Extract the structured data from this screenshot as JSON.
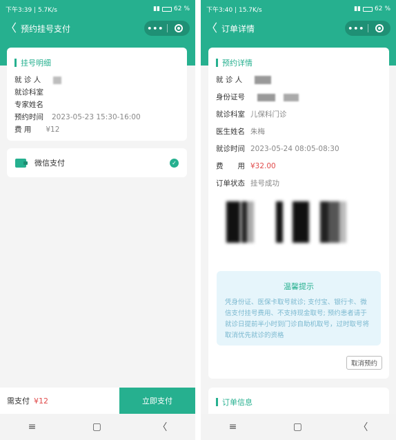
{
  "left": {
    "status": {
      "time_speed": "下午3:39 | 5.7K/s",
      "battery": "62"
    },
    "nav": {
      "back": "〈",
      "title": "预约挂号支付",
      "dots": "•••"
    },
    "detail": {
      "section": "挂号明细",
      "rows": [
        {
          "label": "就 诊 人",
          "value": ""
        },
        {
          "label": "就诊科室",
          "value": ""
        },
        {
          "label": "专家姓名",
          "value": ""
        },
        {
          "label": "预约时间",
          "value": "2023-05-23 15:30-16:00"
        },
        {
          "label": "费 用",
          "value": "¥12"
        }
      ]
    },
    "payment": {
      "label": "微信支付"
    },
    "footer": {
      "need_pay": "需支付",
      "amount": "¥12",
      "pay_button": "立即支付"
    }
  },
  "right": {
    "status": {
      "time_speed": "下午3:40 | 15.7K/s",
      "battery": "62"
    },
    "nav": {
      "back": "〈",
      "title": "订单详情",
      "dots": "•••"
    },
    "detail": {
      "section": "预约详情",
      "rows": [
        {
          "label": "就 诊 人",
          "value": ""
        },
        {
          "label": "身份证号",
          "value": ""
        },
        {
          "label": "就诊科室",
          "value": "儿保科门诊"
        },
        {
          "label": "医生姓名",
          "value": "朱梅"
        },
        {
          "label": "就诊时间",
          "value": "2023-05-24 08:05-08:30"
        },
        {
          "label": "费　　用",
          "value": "¥32.00"
        },
        {
          "label": "订单状态",
          "value": "挂号成功"
        }
      ]
    },
    "tips": {
      "title": "温馨提示",
      "body": "凭身份证、医保卡取号就诊; 支付宝、银行卡、微信支付挂号费用、不支持现金取号; 预约患者请于就诊日提前半小时到门诊自助机取号，过时取号将取消优先就诊的资格"
    },
    "cancel_button": "取消预约",
    "order_section": "订单信息"
  },
  "system_nav": {
    "menu": "≡",
    "home": "▢",
    "back": "〈"
  }
}
